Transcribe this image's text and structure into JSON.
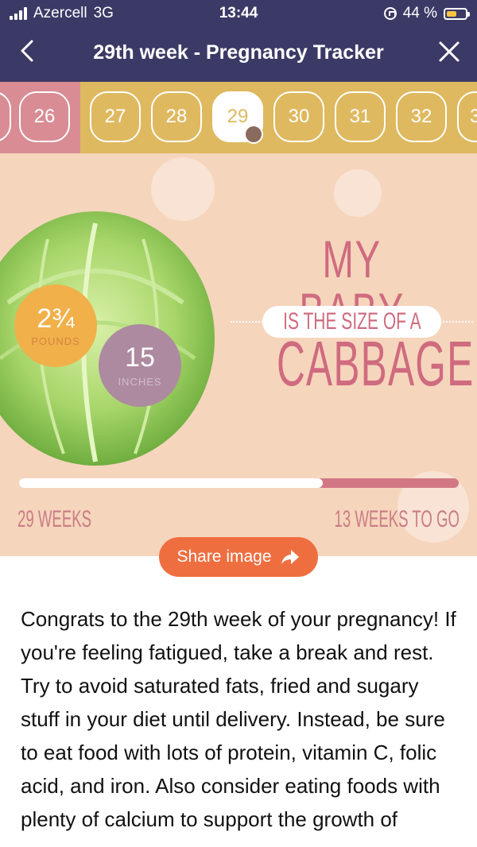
{
  "status_bar": {
    "carrier": "Azercell",
    "network": "3G",
    "time": "13:44",
    "battery_text": "44 %"
  },
  "nav": {
    "title": "29th week - Pregnancy Tracker",
    "back_icon": "chevron-left-icon",
    "close_icon": "close-icon"
  },
  "weeks": {
    "items": [
      "26",
      "27",
      "28",
      "29",
      "30",
      "31",
      "32",
      "3"
    ],
    "selected": "29"
  },
  "hero": {
    "pounds_value": "2¾",
    "pounds_label": "POUNDS",
    "inches_value": "15",
    "inches_label": "INCHES",
    "headline_top": "MY BABY",
    "headline_mid": "IS THE SIZE OF A",
    "headline_bottom": "CABBAGE",
    "progress_fraction": 0.69,
    "weeks_label": "29 WEEKS",
    "to_go_label": "13 WEEKS TO GO"
  },
  "share": {
    "label": "Share image",
    "icon": "share-arrow-icon"
  },
  "content": {
    "paragraph": "Congrats to the 29th week of your pregnancy! If you're feeling fatigued, take a break and rest. Try to avoid saturated fats, fried and sugary stuff in your diet until delivery. Instead, be sure to eat food with lots of protein, vitamin C, folic acid, and iron. Also consider eating foods with plenty of calcium to support the growth of"
  },
  "colors": {
    "header": "#3b3a66",
    "week_bar": "#dfb960",
    "week_bar_past": "#d98c94",
    "accent_pink": "#cf6b7f",
    "share_button": "#ef6e40"
  }
}
